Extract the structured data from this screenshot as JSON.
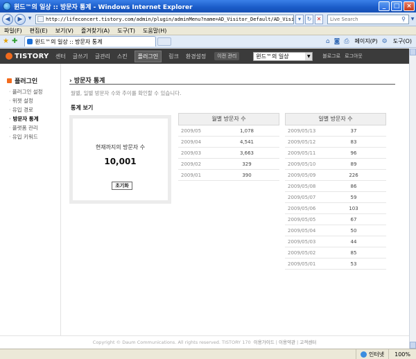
{
  "window": {
    "title": "윈드™의 일상 :: 방문자 통계 - Windows Internet Explorer"
  },
  "address": {
    "url": "http://lifeconcert.tistory.com/admin/plugin/adminMenu?name=AD_Visitor_Default/AD_Visitor_Default",
    "search_placeholder": "Live Search"
  },
  "menubar": [
    "파일(F)",
    "편집(E)",
    "보기(V)",
    "즐겨찾기(A)",
    "도구(T)",
    "도움말(H)"
  ],
  "tab": {
    "label": "윈드™의 일상 :: 방문자 통계"
  },
  "toolbar": {
    "page_label": "페이지(P)",
    "tools_label": "도구(O)"
  },
  "tistory": {
    "logo": "TISTORY",
    "menu": [
      "센터",
      "글쓰기",
      "글관리",
      "스킨",
      "플러그인",
      "링크",
      "환경설정"
    ],
    "active_menu": "플러그인",
    "old_admin": "이전 관리",
    "blog_select": "윈드™의 일상",
    "blog_link": "블로그로",
    "logout": "로그아웃"
  },
  "sidebar": {
    "title": "플러그인",
    "items": [
      {
        "label": "플러그인 설정"
      },
      {
        "label": "위젯 설정"
      },
      {
        "label": "유입 경로"
      },
      {
        "label": "방문자 통계"
      },
      {
        "label": "플랫폼 관리"
      },
      {
        "label": "유입 키워드"
      }
    ],
    "active_item": "방문자 통계"
  },
  "main": {
    "title": "방문자 통계",
    "description": "월별, 일별 방문자 수와 추이를 확인할 수 있습니다.",
    "section_title": "통계 보기",
    "total_label": "현재까지의 방문자 수",
    "total_value": "10,001",
    "reset_button": "초기화"
  },
  "monthly": {
    "header": "월별 방문자 수",
    "rows": [
      {
        "date": "2009/05",
        "value": "1,078"
      },
      {
        "date": "2009/04",
        "value": "4,541"
      },
      {
        "date": "2009/03",
        "value": "3,663"
      },
      {
        "date": "2009/02",
        "value": "329"
      },
      {
        "date": "2009/01",
        "value": "390"
      }
    ]
  },
  "daily": {
    "header": "일별 방문자 수",
    "rows": [
      {
        "date": "2009/05/13",
        "value": "37"
      },
      {
        "date": "2009/05/12",
        "value": "83"
      },
      {
        "date": "2009/05/11",
        "value": "96"
      },
      {
        "date": "2009/05/10",
        "value": "89"
      },
      {
        "date": "2009/05/09",
        "value": "226"
      },
      {
        "date": "2009/05/08",
        "value": "86"
      },
      {
        "date": "2009/05/07",
        "value": "59"
      },
      {
        "date": "2009/05/06",
        "value": "103"
      },
      {
        "date": "2009/05/05",
        "value": "67"
      },
      {
        "date": "2009/05/04",
        "value": "50"
      },
      {
        "date": "2009/05/03",
        "value": "44"
      },
      {
        "date": "2009/05/02",
        "value": "85"
      },
      {
        "date": "2009/05/01",
        "value": "53"
      }
    ]
  },
  "footer": {
    "copyright": "Copyright © Daum Communications. All rights reserved. TISTORY 170",
    "links": [
      "이용가이드",
      "이용약관",
      "고객센터"
    ]
  },
  "statusbar": {
    "zone": "인터넷",
    "zoom": "100%"
  }
}
